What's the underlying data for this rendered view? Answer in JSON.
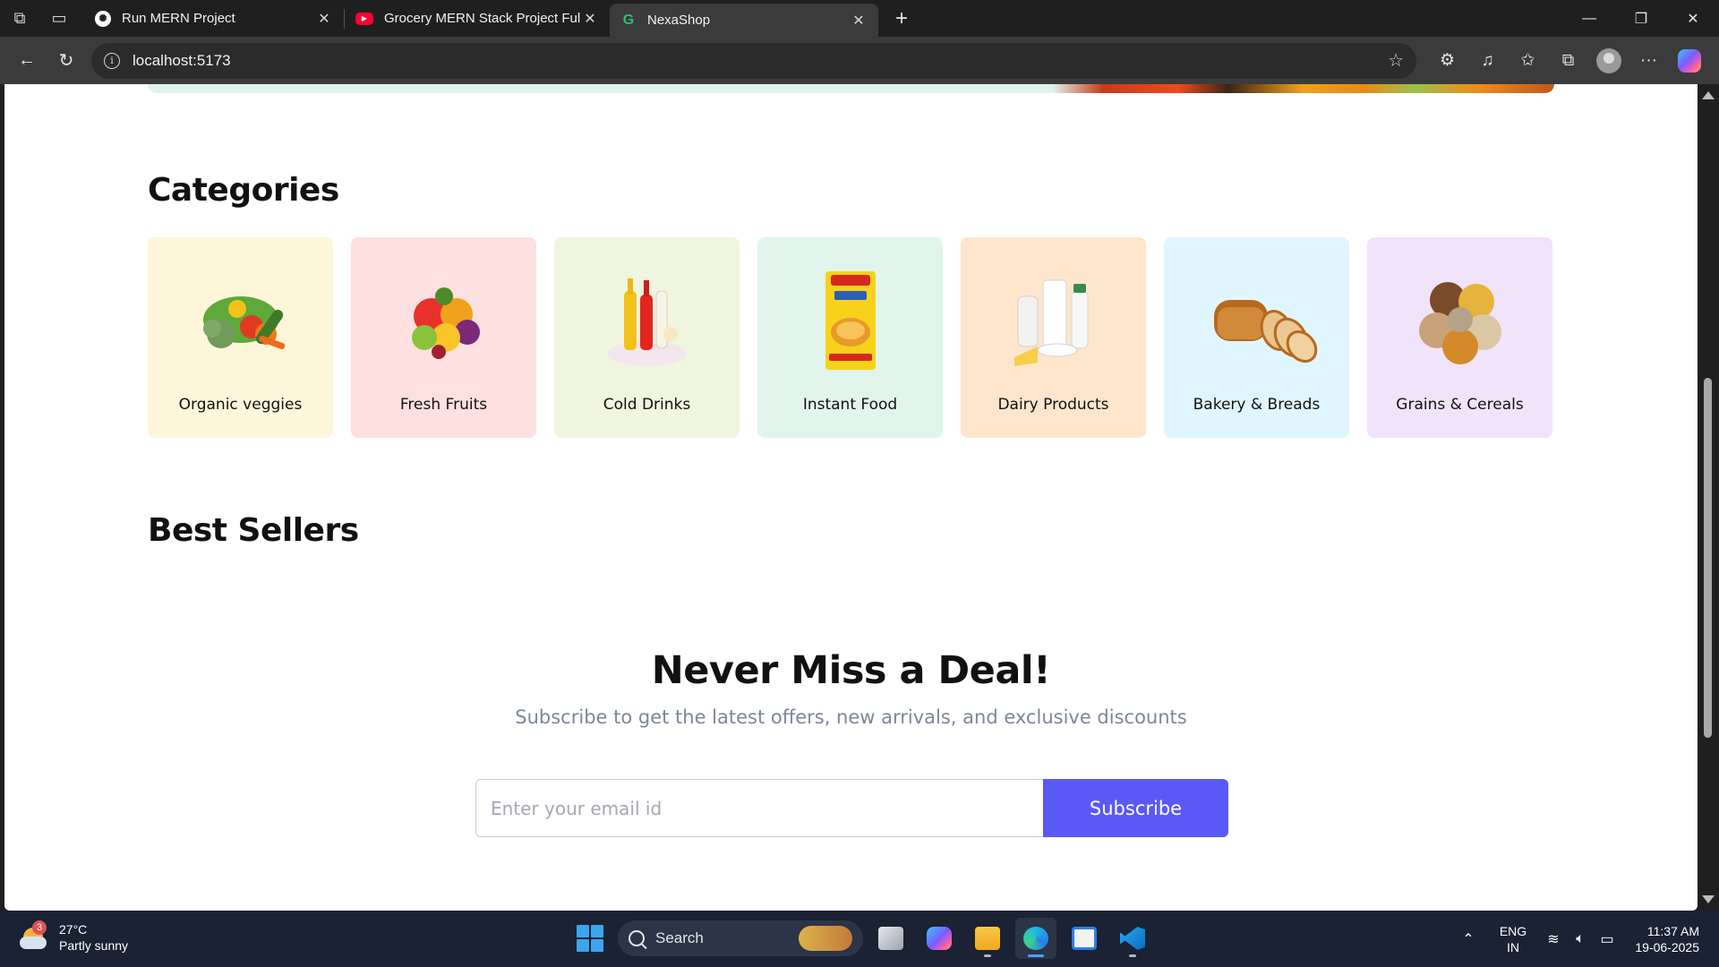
{
  "browser": {
    "tabs": [
      {
        "title": "Run MERN Project",
        "favicon": "chatgpt-icon"
      },
      {
        "title": "Grocery MERN Stack Project Full",
        "favicon": "youtube-icon"
      },
      {
        "title": "NexaShop",
        "favicon": "nexashop-icon",
        "active": true
      }
    ],
    "url": "localhost:5173"
  },
  "page": {
    "categories_title": "Categories",
    "categories": [
      {
        "label": "Organic veggies",
        "bg": "#FEF6DA",
        "icon": "vegetables-icon"
      },
      {
        "label": "Fresh Fruits",
        "bg": "#FEE0E0",
        "icon": "fruits-icon"
      },
      {
        "label": "Cold Drinks",
        "bg": "#F0F5DE",
        "icon": "cold-drinks-icon"
      },
      {
        "label": "Instant Food",
        "bg": "#E1F5EC",
        "icon": "instant-noodles-icon"
      },
      {
        "label": "Dairy Products",
        "bg": "#FEE6CD",
        "icon": "dairy-icon"
      },
      {
        "label": "Bakery & Breads",
        "bg": "#E0F6FE",
        "icon": "bread-icon"
      },
      {
        "label": "Grains & Cereals",
        "bg": "#F1E3F9",
        "icon": "grains-icon"
      }
    ],
    "best_sellers_title": "Best Sellers",
    "newsletter": {
      "title": "Never Miss a Deal!",
      "subtitle": "Subscribe to get the latest offers, new arrivals, and exclusive discounts",
      "email_placeholder": "Enter your email id",
      "button_label": "Subscribe",
      "accent": "#5A59F6"
    }
  },
  "taskbar": {
    "weather": {
      "badge": "3",
      "temp": "27°C",
      "condition": "Partly sunny"
    },
    "search_label": "Search",
    "lang": {
      "line1": "ENG",
      "line2": "IN"
    },
    "time": "11:37 AM",
    "date": "19-06-2025"
  }
}
